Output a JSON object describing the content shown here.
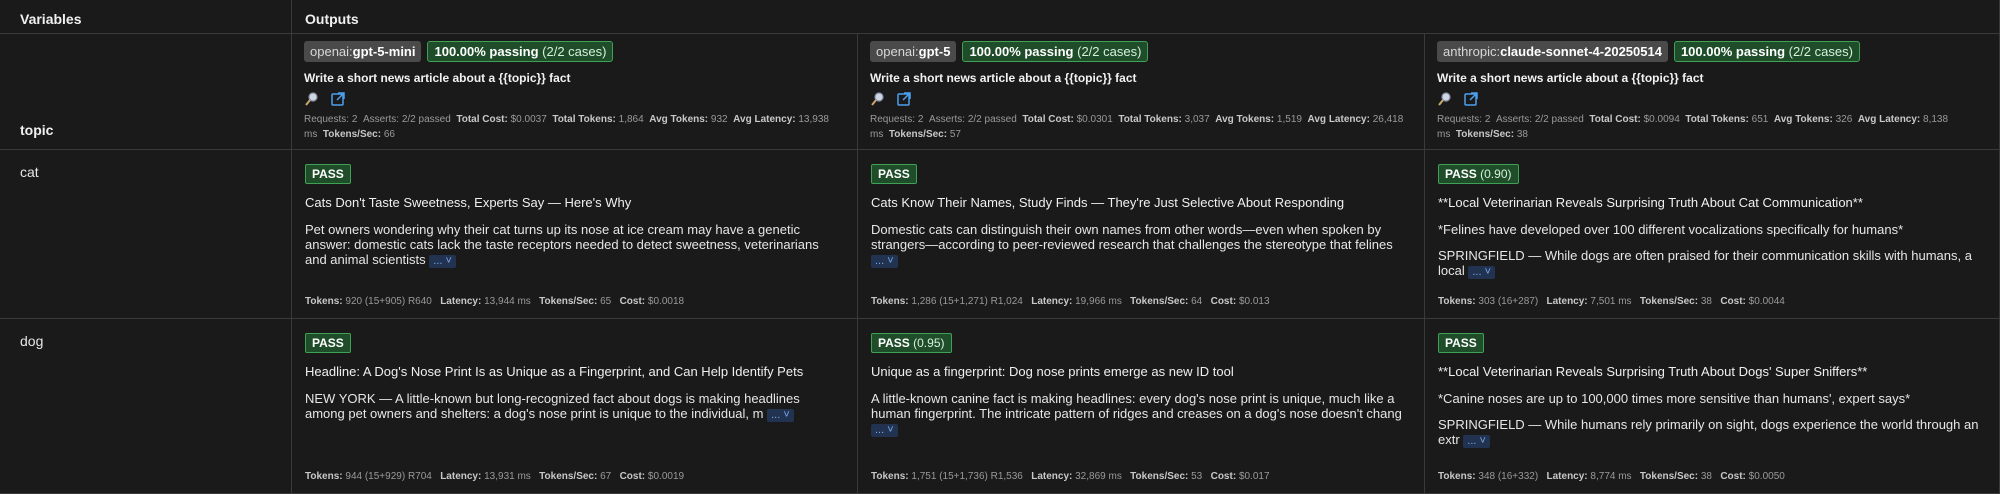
{
  "headers": {
    "variables": "Variables",
    "outputs": "Outputs"
  },
  "variable_name": "topic",
  "rows": [
    {
      "value": "cat"
    },
    {
      "value": "dog"
    }
  ],
  "stats_labels": {
    "requests": "Requests:",
    "asserts": "Asserts:",
    "total_cost": "Total Cost:",
    "total_tokens": "Total Tokens:",
    "avg_tokens": "Avg Tokens:",
    "avg_latency": "Avg Latency:",
    "tokens_sec": "Tokens/Sec:",
    "tokens": "Tokens:",
    "latency": "Latency:",
    "cost": "Cost:"
  },
  "providers": [
    {
      "prefix": "openai:",
      "model": "gpt-5-mini",
      "pass_rate": "100.00% passing",
      "pass_cases": "(2/2 cases)",
      "prompt": "Write a short news article about a {{topic}} fact",
      "requests": "2",
      "asserts": "2/2 passed",
      "total_cost": "$0.0037",
      "total_tokens": "1,864",
      "avg_tokens": "932",
      "avg_latency": "13,938 ms",
      "tokens_sec": "66"
    },
    {
      "prefix": "openai:",
      "model": "gpt-5",
      "pass_rate": "100.00% passing",
      "pass_cases": "(2/2 cases)",
      "prompt": "Write a short news article about a {{topic}} fact",
      "requests": "2",
      "asserts": "2/2 passed",
      "total_cost": "$0.0301",
      "total_tokens": "3,037",
      "avg_tokens": "1,519",
      "avg_latency": "26,418 ms",
      "tokens_sec": "57"
    },
    {
      "prefix": "anthropic:",
      "model": "claude-sonnet-4-20250514",
      "pass_rate": "100.00% passing",
      "pass_cases": "(2/2 cases)",
      "prompt": "Write a short news article about a {{topic}} fact",
      "requests": "2",
      "asserts": "2/2 passed",
      "total_cost": "$0.0094",
      "total_tokens": "651",
      "avg_tokens": "326",
      "avg_latency": "8,138 ms",
      "tokens_sec": "38"
    }
  ],
  "more_label": "...",
  "results": [
    [
      {
        "badge": "PASS",
        "score": "",
        "title": "Cats Don't Taste Sweetness, Experts Say — Here's Why",
        "body": "Pet owners wondering why their cat turns up its nose at ice cream may have a genetic answer: domestic cats lack the taste receptors needed to detect sweetness, veterinarians and animal scientists",
        "tokens": "920 (15+905) R640",
        "latency": "13,944 ms",
        "tokens_sec": "65",
        "cost": "$0.0018"
      },
      {
        "badge": "PASS",
        "score": "",
        "title": "Cats Know Their Names, Study Finds — They're Just Selective About Responding",
        "body": "Domestic cats can distinguish their own names from other words—even when spoken by strangers—according to peer-reviewed research that challenges the stereotype that felines",
        "tokens": "1,286 (15+1,271) R1,024",
        "latency": "19,966 ms",
        "tokens_sec": "64",
        "cost": "$0.013"
      },
      {
        "badge": "PASS",
        "score": "(0.90)",
        "title": "**Local Veterinarian Reveals Surprising Truth About Cat Communication**",
        "subtitle": "*Felines have developed over 100 different vocalizations specifically for humans*",
        "body": "SPRINGFIELD — While dogs are often praised for their communication skills with humans, a local",
        "tokens": "303 (16+287)",
        "latency": "7,501 ms",
        "tokens_sec": "38",
        "cost": "$0.0044"
      }
    ],
    [
      {
        "badge": "PASS",
        "score": "",
        "title": "Headline: A Dog's Nose Print Is as Unique as a Fingerprint, and Can Help Identify Pets",
        "body": "NEW YORK — A little-known but long-recognized fact about dogs is making headlines among pet owners and shelters: a dog's nose print is unique to the individual, m",
        "tokens": "944 (15+929) R704",
        "latency": "13,931 ms",
        "tokens_sec": "67",
        "cost": "$0.0019"
      },
      {
        "badge": "PASS",
        "score": "(0.95)",
        "title": "Unique as a fingerprint: Dog nose prints emerge as new ID tool",
        "body": "A little-known canine fact is making headlines: every dog's nose print is unique, much like a human fingerprint. The intricate pattern of ridges and creases on a dog's nose doesn't chang",
        "tokens": "1,751 (15+1,736) R1,536",
        "latency": "32,869 ms",
        "tokens_sec": "53",
        "cost": "$0.017"
      },
      {
        "badge": "PASS",
        "score": "",
        "title": "**Local Veterinarian Reveals Surprising Truth About Dogs' Super Sniffers**",
        "subtitle": "*Canine noses are up to 100,000 times more sensitive than humans', expert says*",
        "body": "SPRINGFIELD — While humans rely primarily on sight, dogs experience the world through an extr",
        "tokens": "348 (16+332)",
        "latency": "8,774 ms",
        "tokens_sec": "38",
        "cost": "$0.0050"
      }
    ]
  ],
  "icons": {
    "search": "magnifier-icon",
    "open": "open-external-icon",
    "more": "chevron-down-icon"
  },
  "colors": {
    "pass_bg": "#1f4d2a",
    "pass_border": "#3ea155",
    "background": "#1a1a1a"
  }
}
